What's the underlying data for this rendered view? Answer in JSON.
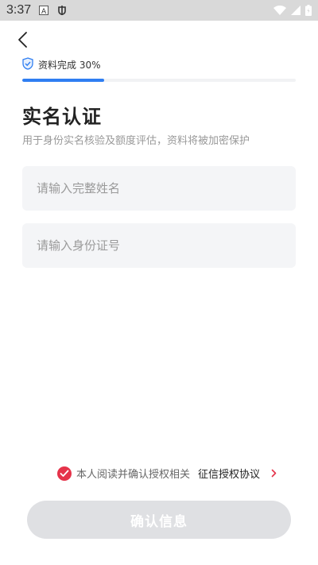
{
  "status_bar": {
    "time": "3:37",
    "icons": [
      "keyboard-icon",
      "notification-bug-icon",
      "wifi-icon",
      "signal-icon",
      "battery-icon"
    ]
  },
  "header": {
    "back_icon": "chevron-left-icon"
  },
  "progress": {
    "label": "资料完成 30%",
    "value": 0.3,
    "accent_color": "#2f7ef2"
  },
  "main": {
    "title": "实名认证",
    "subtitle": "用于身份实名核验及额度评估，资料将被加密保护",
    "name_field": {
      "placeholder": "请输入完整姓名",
      "value": ""
    },
    "id_field": {
      "placeholder": "请输入身份证号",
      "value": ""
    }
  },
  "agreement": {
    "checked": true,
    "text": "本人阅读并确认授权相关",
    "link_text": "征信授权协议",
    "check_color": "#e5334a"
  },
  "footer": {
    "confirm_label": "确认信息"
  }
}
